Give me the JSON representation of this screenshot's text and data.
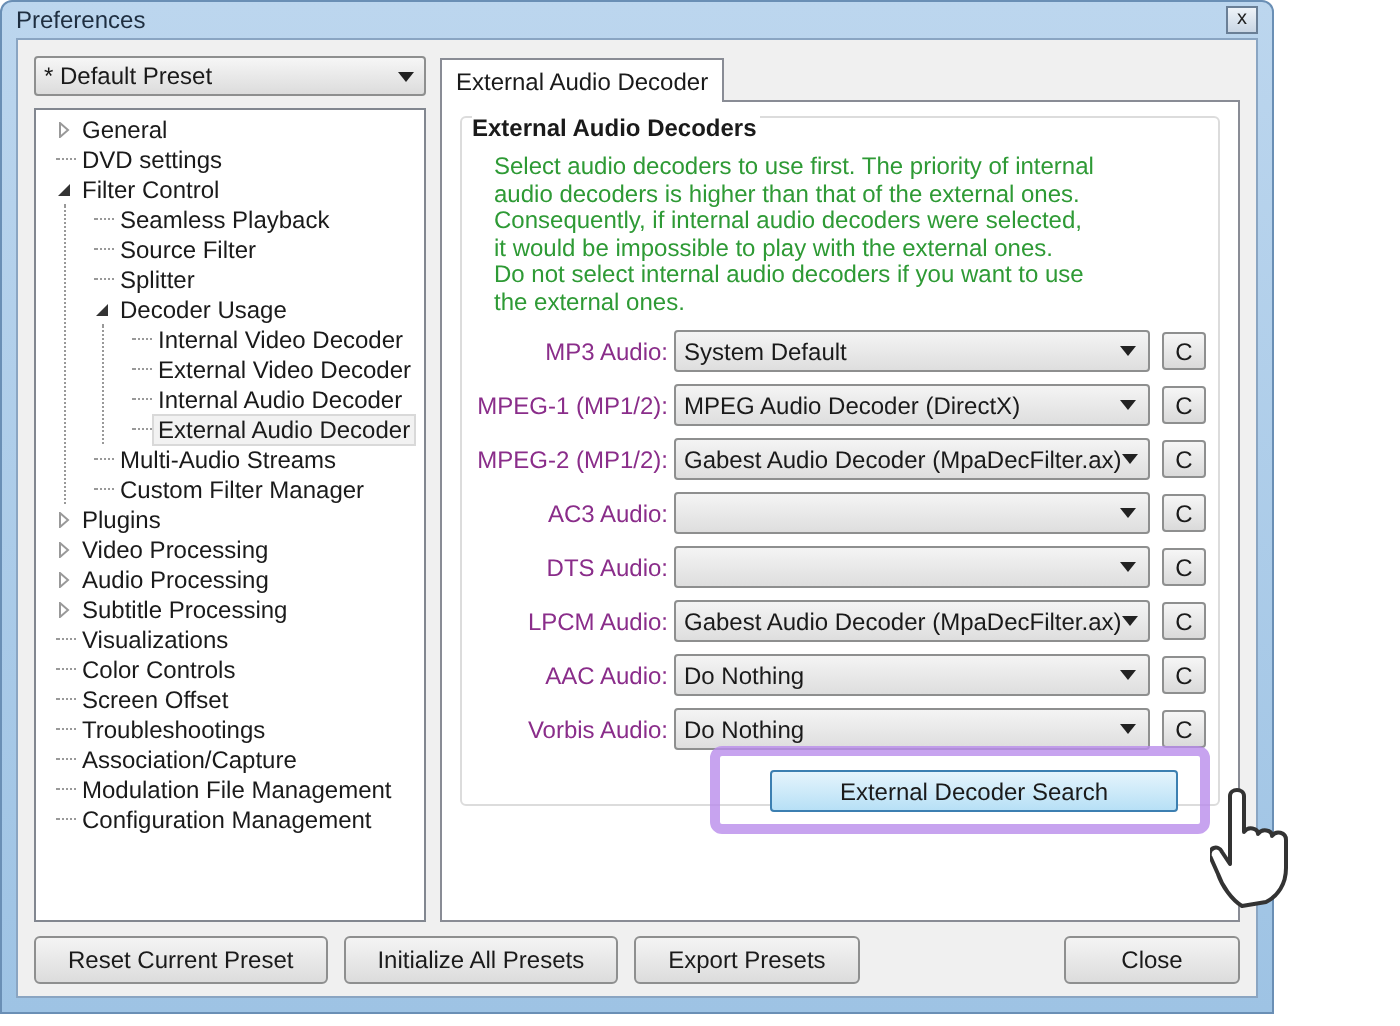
{
  "window": {
    "title": "Preferences",
    "close_label": "x"
  },
  "preset": {
    "value": "* Default Preset"
  },
  "tree": [
    {
      "label": "General",
      "expanded": false,
      "selected": false
    },
    {
      "label": "DVD settings",
      "selected": false
    },
    {
      "label": "Filter Control",
      "expanded": true,
      "selected": false,
      "children": [
        {
          "label": "Seamless Playback",
          "selected": false
        },
        {
          "label": "Source Filter",
          "selected": false
        },
        {
          "label": "Splitter",
          "selected": false
        },
        {
          "label": "Decoder Usage",
          "expanded": true,
          "selected": false,
          "children": [
            {
              "label": "Internal Video Decoder",
              "selected": false
            },
            {
              "label": "External Video Decoder",
              "selected": false
            },
            {
              "label": "Internal Audio Decoder",
              "selected": false
            },
            {
              "label": "External Audio Decoder",
              "selected": true
            }
          ]
        },
        {
          "label": "Multi-Audio Streams",
          "selected": false
        },
        {
          "label": "Custom Filter Manager",
          "selected": false
        }
      ]
    },
    {
      "label": "Plugins",
      "expanded": false,
      "selected": false
    },
    {
      "label": "Video Processing",
      "expanded": false,
      "selected": false
    },
    {
      "label": "Audio Processing",
      "expanded": false,
      "selected": false
    },
    {
      "label": "Subtitle Processing",
      "expanded": false,
      "selected": false
    },
    {
      "label": "Visualizations",
      "selected": false
    },
    {
      "label": "Color Controls",
      "selected": false
    },
    {
      "label": "Screen Offset",
      "selected": false
    },
    {
      "label": "Troubleshootings",
      "selected": false
    },
    {
      "label": "Association/Capture",
      "selected": false
    },
    {
      "label": "Modulation File Management",
      "selected": false
    },
    {
      "label": "Configuration Management",
      "selected": false
    }
  ],
  "tabs": [
    {
      "label": "External Audio Decoder",
      "selected": true
    }
  ],
  "group": {
    "title": "External Audio Decoders",
    "description": [
      "Select audio decoders to use first. The priority of internal",
      "audio decoders is higher than that of the external ones.",
      "Consequently, if internal audio decoders were selected,",
      "it would be impossible to play with the external ones.",
      "Do not select internal audio decoders if you want to use",
      "the external ones."
    ],
    "decoders": [
      {
        "label": "MP3 Audio:",
        "value": "System Default",
        "clear": "C"
      },
      {
        "label": "MPEG-1 (MP1/2):",
        "value": "MPEG Audio Decoder (DirectX)",
        "clear": "C"
      },
      {
        "label": "MPEG-2 (MP1/2):",
        "value": "Gabest Audio Decoder (MpaDecFilter.ax)",
        "clear": "C"
      },
      {
        "label": "AC3 Audio:",
        "clear": "C"
      },
      {
        "label": "DTS Audio:",
        "clear": "C"
      },
      {
        "label": "LPCM Audio:",
        "value": "Gabest Audio Decoder (MpaDecFilter.ax)",
        "clear": "C"
      },
      {
        "label": "AAC Audio:",
        "value": "Do Nothing",
        "clear": "C"
      },
      {
        "label": "Vorbis Audio:",
        "value": "Do Nothing",
        "clear": "C"
      }
    ],
    "search_button": {
      "label": "External Decoder Search",
      "highlighted": true
    }
  },
  "buttons": [
    {
      "label": "Reset Current Preset"
    },
    {
      "label": "Initialize All Presets"
    },
    {
      "label": "Export Presets"
    },
    {
      "label": "Close"
    }
  ]
}
